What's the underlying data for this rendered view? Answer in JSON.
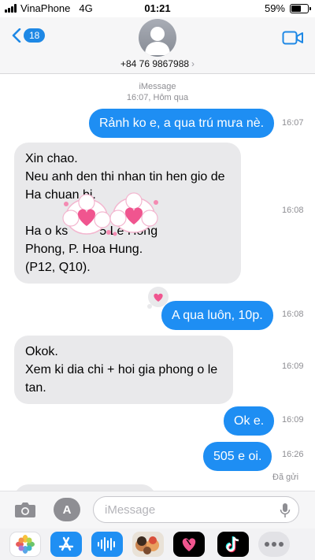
{
  "status_bar": {
    "carrier": "VinaPhone",
    "network": "4G",
    "time": "01:21",
    "battery": "59%",
    "battery_level": 0.59
  },
  "header": {
    "back_count": "18",
    "contact": "+84 76 9867988",
    "chevron": "›"
  },
  "thread": {
    "service": "iMessage",
    "date": "16:07, Hôm qua",
    "messages": [
      {
        "dir": "out",
        "text": "Rảnh ko e, a qua trú mưa nè.",
        "time": "16:07"
      },
      {
        "dir": "in",
        "lines": [
          "Xin chao.",
          "Neu anh den thi nhan tin hen gio de",
          "Ha chuan bi.",
          "",
          "Ha o ks         5 Le Hong",
          "Phong, P. Hoa Hung.",
          "(P12, Q10)."
        ],
        "time": "16:08"
      },
      {
        "dir": "out",
        "text": "A qua luôn, 10p.",
        "time": "16:08"
      },
      {
        "dir": "in",
        "lines": [
          "Okok.",
          "Xem ki dia chi + hoi gia phong o le",
          "tan."
        ],
        "time": "16:09"
      },
      {
        "dir": "out",
        "text": "Ok e.",
        "time": "16:09"
      },
      {
        "dir": "out",
        "text": "505 e oi.",
        "time": "16:26"
      }
    ],
    "delivered": "Đã gửi"
  },
  "compose": {
    "placeholder": "iMessage",
    "appstore_glyph": "A"
  },
  "app_drawer": {
    "icons": [
      "photos-icon",
      "app-store-icon",
      "audio-message-icon",
      "memoji-icon",
      "digital-touch-icon",
      "tiktok-icon",
      "more-icon"
    ]
  },
  "colors": {
    "outgoing_bubble": "#1e8ef3",
    "incoming_bubble": "#e9e9eb",
    "accent": "#1e88e5"
  }
}
